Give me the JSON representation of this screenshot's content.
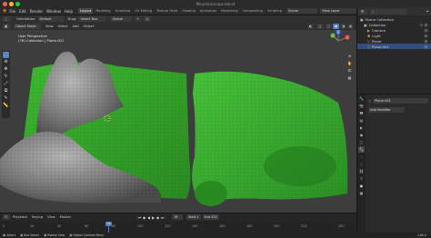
{
  "window": {
    "title": "Mountainscape.blend"
  },
  "topbar": {
    "menus": [
      "File",
      "Edit",
      "Render",
      "Window",
      "Help"
    ],
    "workspaces": [
      "Layout",
      "Modeling",
      "Sculpting",
      "UV Editing",
      "Texture Paint",
      "Shading",
      "Animation",
      "Rendering",
      "Compositing",
      "Scripting"
    ],
    "active_workspace": "Layout",
    "scene_label": "Scene",
    "view_layer_label": "View Layer"
  },
  "tool_header": {
    "orientation_label": "Orientation:",
    "orientation_value": "Default",
    "drag_label": "Drag:",
    "drag_value": "Select Box",
    "transform_value": "Global"
  },
  "viewport_header": {
    "mode": "Object Mode",
    "menus": [
      "View",
      "Select",
      "Add",
      "Object"
    ]
  },
  "viewport": {
    "perspective": "User Perspective",
    "collection_info": "(76) Collection | Plane.001",
    "gizmo_axes": [
      "X",
      "Y",
      "Z"
    ]
  },
  "outliner": {
    "header": "Scene Collection",
    "items": [
      {
        "label": "Collection",
        "indent": 1
      },
      {
        "label": "Camera",
        "indent": 2
      },
      {
        "label": "Light",
        "indent": 2
      },
      {
        "label": "Plane",
        "indent": 2
      },
      {
        "label": "Plane.001",
        "indent": 2
      }
    ]
  },
  "properties": {
    "object_name": "Plane.001",
    "add_modifier": "Add Modifier"
  },
  "timeline": {
    "menus": [
      "Playback",
      "Keying",
      "View",
      "Marker"
    ],
    "ticks": [
      "0",
      "20",
      "40",
      "60",
      "80",
      "100",
      "120",
      "140",
      "160",
      "180",
      "200",
      "220",
      "250"
    ],
    "current_frame": "76",
    "start": "1",
    "end": "250",
    "start_label": "Start",
    "end_label": "End"
  },
  "statusbar": {
    "left": "Select",
    "middle1": "Box Select",
    "middle2": "Rotate View",
    "middle3": "Object Context Menu",
    "version": "2.80.0"
  },
  "colors": {
    "accent": "#4f7ec5",
    "terrain_green": "#36a72c",
    "terrain_gray": "#8a8a8a",
    "playhead": "#4f7ec5"
  }
}
